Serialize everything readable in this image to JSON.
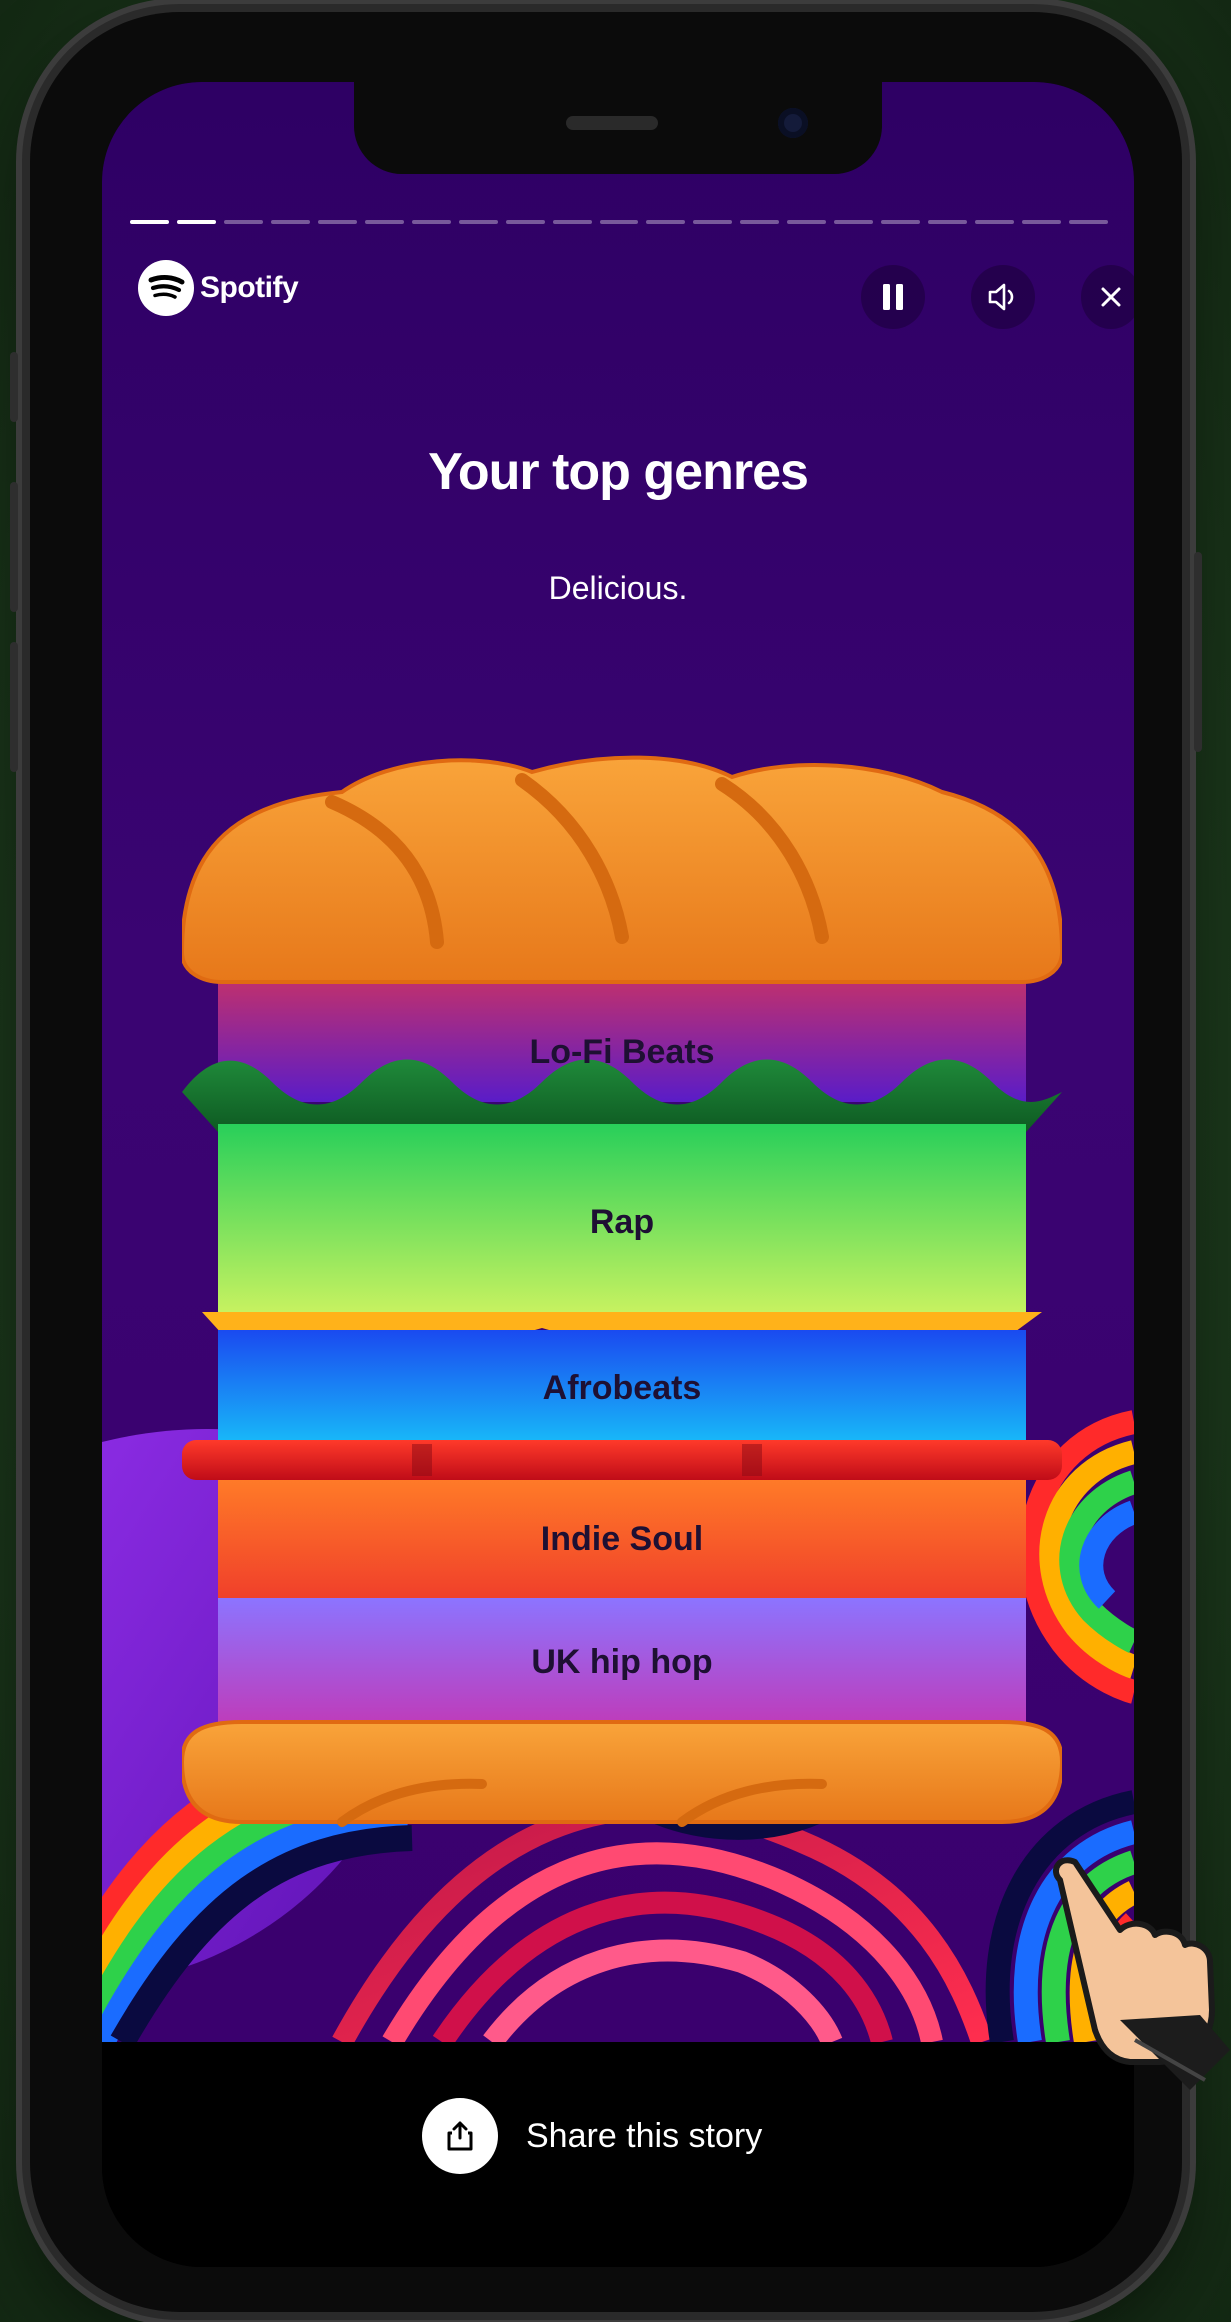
{
  "header": {
    "brand": "Spotify",
    "progress": {
      "total_segments": 21,
      "completed_segments": 2
    },
    "controls": {
      "pause_icon": "pause-icon",
      "volume_icon": "volume-icon",
      "close_icon": "close-icon"
    }
  },
  "story": {
    "title": "Your top genres",
    "subtitle": "Delicious.",
    "genres": [
      {
        "rank": 1,
        "label": "Lo-Fi Beats"
      },
      {
        "rank": 2,
        "label": "Rap"
      },
      {
        "rank": 3,
        "label": "Afrobeats"
      },
      {
        "rank": 4,
        "label": "Indie Soul"
      },
      {
        "rank": 5,
        "label": "UK hip hop"
      }
    ]
  },
  "footer": {
    "share_label": "Share this story",
    "share_icon": "share-icon"
  },
  "colors": {
    "background": "#3a046e",
    "bread": "#f08a24",
    "lofi": "#d8364f",
    "rap": "#3fd46a",
    "afrobeats": "#1b7ce8",
    "indie_soul": "#ff6a1f",
    "uk_hip_hop": "#9a6bff"
  }
}
